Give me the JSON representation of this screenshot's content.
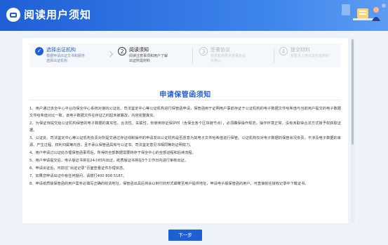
{
  "header": {
    "title": "阅读用户须知"
  },
  "steps": [
    {
      "num": "✓",
      "title": "选择出证机构",
      "desc": [
        "根据申请出证文书和服务",
        "选择出证机构"
      ],
      "state": "done"
    },
    {
      "num": "2",
      "title": "阅读须知",
      "desc": [
        "阅读注意事项和用户了解",
        "出证所需材料"
      ],
      "state": "current"
    },
    {
      "num": "3",
      "title": "签署协议",
      "desc": [
        "根据机构要求签署协议",
        "并确认"
      ],
      "state": "todo"
    },
    {
      "num": "4",
      "title": "提交材料",
      "desc": [
        "按要求上传出证所需材料"
      ],
      "state": "todo"
    }
  ],
  "document": {
    "title": "申请保管函须知",
    "paragraphs": [
      "1、用户通过该全中心平台向保全中心系统对接的公证处、司法鉴定中心等公证机构进行保管函申请，保管函用于证明用户事前存证于公证机构的电子数据文件哈希值与当前用户提交的电子数据文件哈希值对比一致，该电子数据文件在存证之时起未被篡改，内容完整真实。",
      "2、为保证待提交给公证机构保管的电子数据的真实性、合法性、关联性，你使用存证保护时（含保全各个区块链节点），必须确保操作规范，操作环境正常，没有未取得合法方式授予权获取证据。",
      "3、公证处、司法鉴定中心等公证机构负责对所提交通过存证线制操作的申请发出公证机构是否愿意为其电子文件哈希值进行保管。公证机构仅对电子数据的保管状况负责，不涉及电子数据的来源、产生过程、权利归属等内容，且不承认保管函具有与公证书、司法鉴定意见书相同等的证明效力。",
      "4、用户申请过公证处办理保管函事项后，所得的全部数据需要转存于保全中心的全部进程和后续流程。",
      "5、用户申请提交后，电子版证书将在24小时内出证，纸质版证书将在5个工作日内进行审核出证。",
      "6、申请出证后，可前往“出证记录”页面查看证件办理状态。",
      "7、如果您申请出证中有任何疑问，请拨打400 808 5187。",
      "8、申请纸质版保管函的用户需务必填写正确的收货地址，保管函出具后将会以到付的形式邮寄至用户提供地址，申请电子版保管函的用户，可直接前往授权记录中下载证书。"
    ]
  },
  "buttons": {
    "next": "下一步"
  }
}
